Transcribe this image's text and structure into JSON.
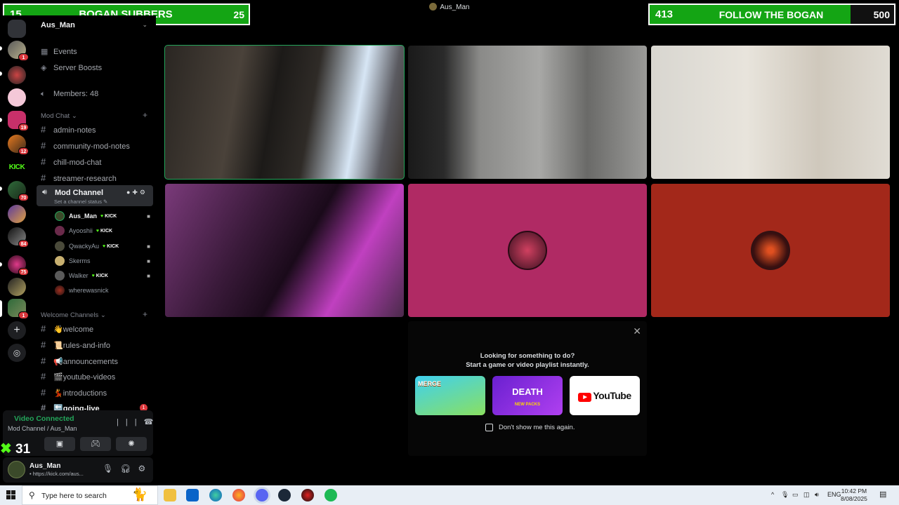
{
  "window": {
    "title": "Aus_Man"
  },
  "overlays": {
    "left": {
      "count": "15",
      "label": "BOGAN SUBBERS",
      "goal": "25"
    },
    "right": {
      "count": "413",
      "label": "FOLLOW THE BOGAN",
      "goal": "500"
    }
  },
  "rail": {
    "badges": [
      "1",
      "19",
      "12",
      "70",
      "84",
      "75",
      "1"
    ],
    "kick_label": "KICK"
  },
  "sidebar": {
    "server_name": "Aus_Man",
    "menu": [
      "Events",
      "Server Boosts",
      "Members: 48"
    ],
    "categories": {
      "mod_chat": "Mod Chat",
      "welcome": "Welcome Channels"
    },
    "mod_channels": [
      "admin-notes",
      "community-mod-notes",
      "chill-mod-chat",
      "streamer-research"
    ],
    "voice_channel": {
      "name": "Mod Channel",
      "status_hint": "Set a channel status"
    },
    "voice_users": [
      {
        "name": "Aus_Man",
        "kick": true
      },
      {
        "name": "Ayooshii",
        "kick": true
      },
      {
        "name": "QwackyAu",
        "kick": true
      },
      {
        "name": "Skerms",
        "kick": false
      },
      {
        "name": "Walker",
        "kick": true
      },
      {
        "name": "wherewasnick",
        "kick": false
      }
    ],
    "kick_tag": "KICK",
    "welcome_channels": [
      "👋welcome",
      "📜rules-and-info",
      "📢announcements",
      "🎬youtube-videos",
      "💃introductions",
      "🔙going-live"
    ],
    "going_live_badge": "1"
  },
  "voice_panel": {
    "status": "Video Connected",
    "location": "Mod Channel / Aus_Man"
  },
  "user_panel": {
    "username": "Aus_Man",
    "status": "• https://kick.com/aus..."
  },
  "kick_counter": "31",
  "activity": {
    "line1": "Looking for something to do?",
    "line2": "Start a game or video playlist instantly.",
    "cards": [
      "MERGE",
      "DEATH",
      "YouTube"
    ],
    "death_sub": "NEW PACKS",
    "dont_show": "Don't show me this again."
  },
  "taskbar": {
    "search_placeholder": "Type here to search",
    "language": "ENG",
    "time": "10:42 PM",
    "date": "8/08/2025"
  },
  "colors": {
    "overlay_green": "#14a514",
    "speaking_green": "#23a55a",
    "tile_pink": "#b02a64",
    "tile_red": "#a3281a",
    "kick_green": "#53fc18"
  }
}
